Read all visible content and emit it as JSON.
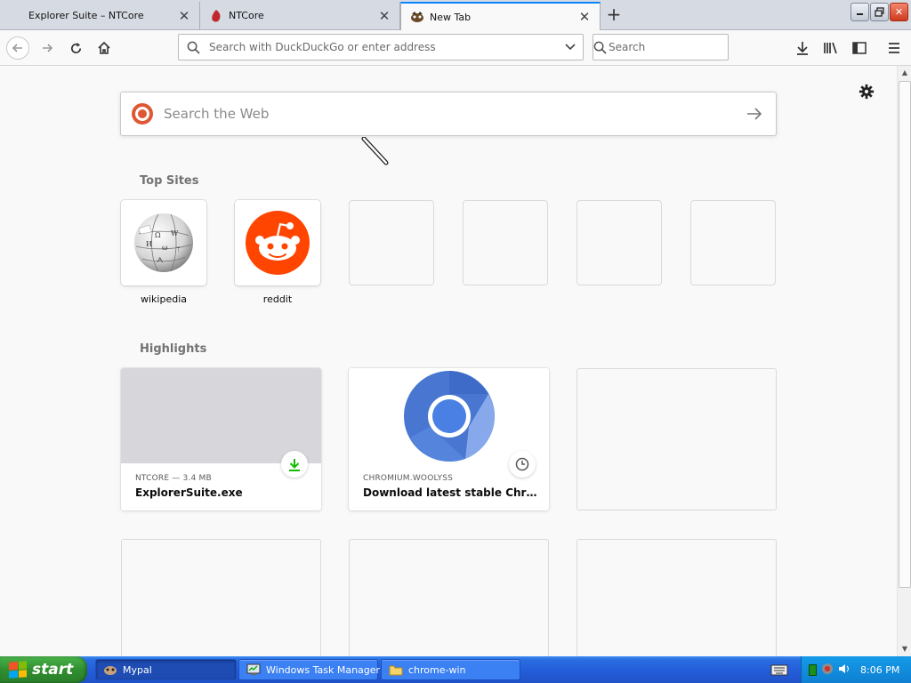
{
  "tabs": [
    {
      "title": "Explorer Suite – NTCore"
    },
    {
      "title": "NTCore"
    },
    {
      "title": "New Tab"
    }
  ],
  "urlbar": {
    "placeholder": "Search with DuckDuckGo or enter address"
  },
  "searchbar": {
    "placeholder": "Search"
  },
  "newtab": {
    "search_placeholder": "Search the Web",
    "top_sites_title": "Top Sites",
    "top_sites": [
      {
        "label": "wikipedia",
        "icon": "wikipedia-globe-icon"
      },
      {
        "label": "reddit",
        "icon": "reddit-alien-icon"
      },
      {
        "label": ""
      },
      {
        "label": ""
      },
      {
        "label": ""
      },
      {
        "label": ""
      }
    ],
    "highlights_title": "Highlights",
    "highlights": [
      {
        "meta": "NTCORE — 3.4 MB",
        "title": "ExplorerSuite.exe",
        "badge": "download-icon"
      },
      {
        "meta": "CHROMIUM.WOOLYSS",
        "title": "Download latest stable Chromiu...",
        "badge": "clock-icon"
      }
    ]
  },
  "taskbar": {
    "start_label": "start",
    "tasks": [
      {
        "label": "Mypal"
      },
      {
        "label": "Windows Task Manager"
      },
      {
        "label": "chrome-win"
      }
    ],
    "clock": "8:06 PM"
  },
  "colors": {
    "accent": "#0a84ff",
    "reddit": "#ff4500",
    "download_green": "#12bc00",
    "taskbar_blue": "#245edb"
  }
}
